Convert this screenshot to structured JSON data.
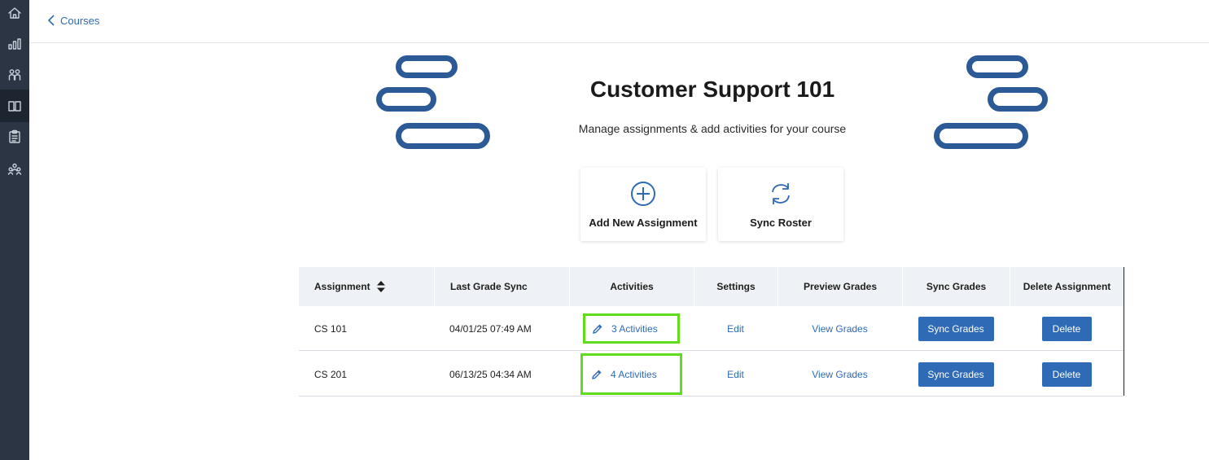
{
  "sidebar": {
    "items": [
      {
        "icon": "home-icon",
        "active": false
      },
      {
        "icon": "bar-chart-icon",
        "active": false
      },
      {
        "icon": "people-icon",
        "active": false
      },
      {
        "icon": "book-icon",
        "active": true
      },
      {
        "icon": "clipboard-icon",
        "active": false
      },
      {
        "icon": "group-icon",
        "active": false
      }
    ]
  },
  "breadcrumb": {
    "back_label": "Courses"
  },
  "hero": {
    "title": "Customer Support 101",
    "subtitle": "Manage assignments & add activities for your course"
  },
  "actions": {
    "add_label": "Add New Assignment",
    "sync_label": "Sync Roster"
  },
  "table": {
    "headers": {
      "assignment": "Assignment",
      "last_sync": "Last Grade Sync",
      "activities": "Activities",
      "settings": "Settings",
      "preview": "Preview Grades",
      "sync": "Sync Grades",
      "delete": "Delete Assignment"
    },
    "rows": [
      {
        "name": "CS 101",
        "last_sync": "04/01/25 07:49 AM",
        "activities": "3 Activities",
        "settings": "Edit",
        "preview": "View Grades",
        "sync": "Sync Grades",
        "delete": "Delete"
      },
      {
        "name": "CS 201",
        "last_sync": "06/13/25 04:34 AM",
        "activities": "4 Activities",
        "settings": "Edit",
        "preview": "View Grades",
        "sync": "Sync Grades",
        "delete": "Delete"
      }
    ]
  },
  "colors": {
    "accent": "#2e6ab5",
    "highlight": "#5fdc1a",
    "sidebar": "#2b3544",
    "deco": "#2c5a97"
  }
}
